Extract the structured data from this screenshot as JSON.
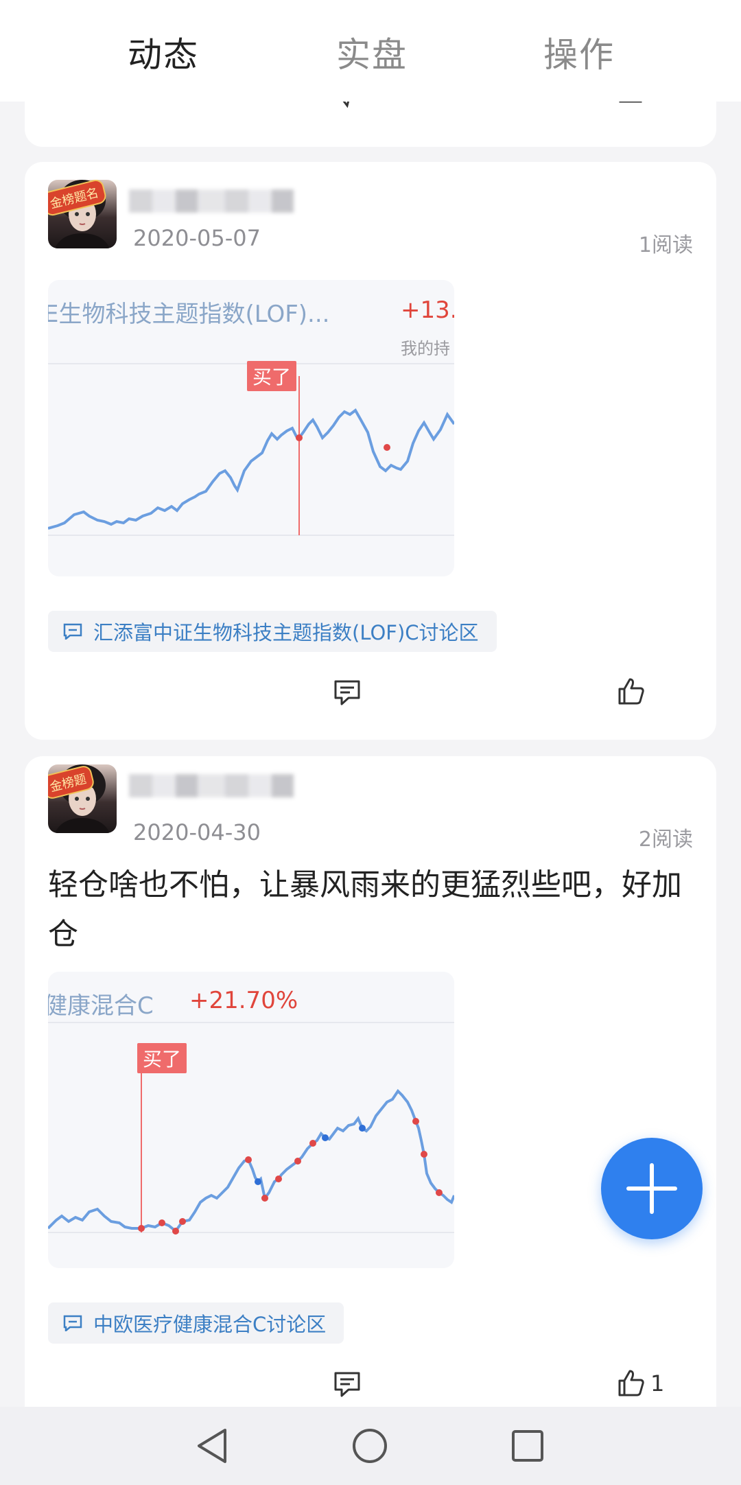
{
  "tabs": [
    {
      "label": "动态",
      "active": true
    },
    {
      "label": "实盘",
      "active": false
    },
    {
      "label": "操作",
      "active": false
    }
  ],
  "posts": [
    {
      "date": "2020-05-07",
      "reads": "1阅读",
      "text": "",
      "avatar_badge": "金榜题名",
      "chart": {
        "title": "E生物科技主题指数(LOF)...",
        "change": "+13.",
        "subtitle": "我的持",
        "buy_label": "买了"
      },
      "topic": "汇添富中证生物科技主题指数(LOF)C讨论区",
      "like_count": ""
    },
    {
      "date": "2020-04-30",
      "reads": "2阅读",
      "text": "轻仓啥也不怕，让暴风雨来的更猛烈些吧，好加仓",
      "avatar_badge": "金榜题",
      "chart": {
        "title": "健康混合C",
        "change": "+21.70%",
        "subtitle": "",
        "buy_label": "买了"
      },
      "topic": "中欧医疗健康混合C讨论区",
      "like_count": "1"
    }
  ],
  "icons": {
    "comment": "comment-icon",
    "like": "thumbs-up-icon",
    "fab": "plus-icon",
    "nav": [
      "back-triangle-icon",
      "home-circle-icon",
      "recents-square-icon"
    ]
  },
  "colors": {
    "accent": "#2f80ee",
    "link": "#3c7fc4",
    "up_red": "#e0453b",
    "line": "#6b9ee0"
  }
}
